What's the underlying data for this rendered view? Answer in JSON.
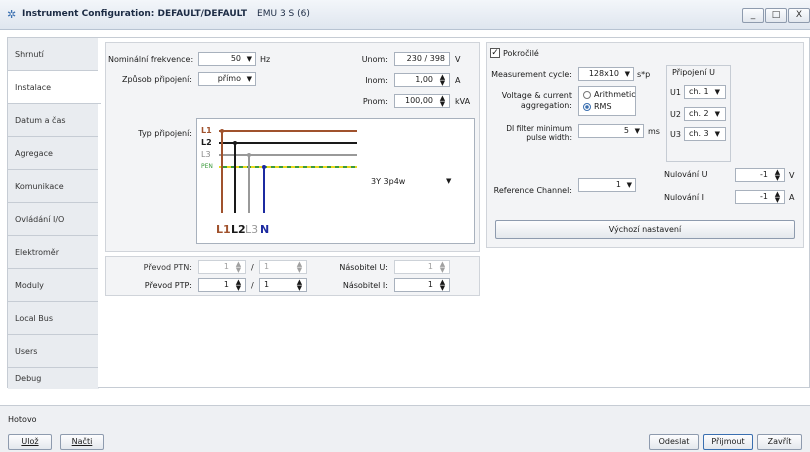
{
  "window": {
    "title": "Instrument Configuration: DEFAULT/DEFAULT",
    "subtitle": "EMU 3 S (6)",
    "controls": [
      "_",
      "□",
      "X"
    ]
  },
  "tabs": [
    "Shrnutí",
    "Instalace",
    "Datum a čas",
    "Agregace",
    "Komunikace",
    "Ovládání I/O",
    "Elektroměr",
    "Moduly",
    "Local Bus",
    "Users",
    "Debug"
  ],
  "active_tab": "Instalace",
  "install": {
    "nominal_freq_label": "Nominální frekvence:",
    "nominal_freq_value": "50",
    "nominal_freq_unit": "Hz",
    "connection_method_label": "Způsob připojení:",
    "connection_method_value": "přímo",
    "unom_label": "Unom:",
    "unom_value": "230 / 398",
    "unom_unit": "V",
    "inom_label": "Inom:",
    "inom_value": "1,00",
    "inom_unit": "A",
    "pnom_label": "Pnom:",
    "pnom_value": "100,00",
    "pnom_unit": "kVA",
    "conn_type_label": "Typ připojení:",
    "wire_labels": [
      "L1",
      "L2",
      "L3",
      "PEN"
    ],
    "terminal_labels": [
      "L1",
      "L2",
      "L3",
      "N"
    ],
    "conn_type_value": "3Y  3p4w"
  },
  "ratios": {
    "ptn_label": "Převod PTN:",
    "ptn_a": "1",
    "ptn_b": "1",
    "mult_u_label": "Násobitel U:",
    "mult_u": "1",
    "ptp_label": "Převod PTP:",
    "ptp_a": "1",
    "ptp_b": "1",
    "mult_i_label": "Násobitel I:",
    "mult_i": "1",
    "slash": "/"
  },
  "advanced": {
    "checkbox_label": "Pokročilé",
    "checked": true,
    "meas_cycle_label": "Measurement cycle:",
    "meas_cycle_value": "128x10",
    "meas_cycle_unit": "s*p",
    "aggregation_label_1": "Voltage & current",
    "aggregation_label_2": "aggregation:",
    "agg_option_1": "Arithmetic",
    "agg_option_2": "RMS",
    "agg_selected": "RMS",
    "di_filter_label_1": "DI filter minimum",
    "di_filter_label_2": "pulse width:",
    "di_filter_value": "5",
    "di_filter_unit": "ms",
    "connect_u_title": "Připojení U",
    "connect_u": [
      {
        "label": "U1",
        "value": "ch. 1"
      },
      {
        "label": "U2",
        "value": "ch. 2"
      },
      {
        "label": "U3",
        "value": "ch. 3"
      }
    ],
    "ref_channel_label": "Reference Channel:",
    "ref_channel_value": "1",
    "reset_u_label": "Nulování U",
    "reset_u_value": "-1",
    "reset_u_unit": "V",
    "reset_i_label": "Nulování I",
    "reset_i_value": "-1",
    "reset_i_unit": "A",
    "defaults_button": "Výchozí nastavení"
  },
  "status": {
    "text": "Hotovo",
    "save_button": "Ulož",
    "load_button": "Načti",
    "send_button": "Odeslat",
    "accept_button": "Přijmout",
    "close_button": "Zavřít"
  },
  "colors": {
    "L1": "#a0522d",
    "L2": "#1a1a1a",
    "L3": "#999999",
    "PEN_green": "#3a9a3a",
    "PEN_yellow": "#e8d820",
    "N": "#1c2aa0"
  }
}
